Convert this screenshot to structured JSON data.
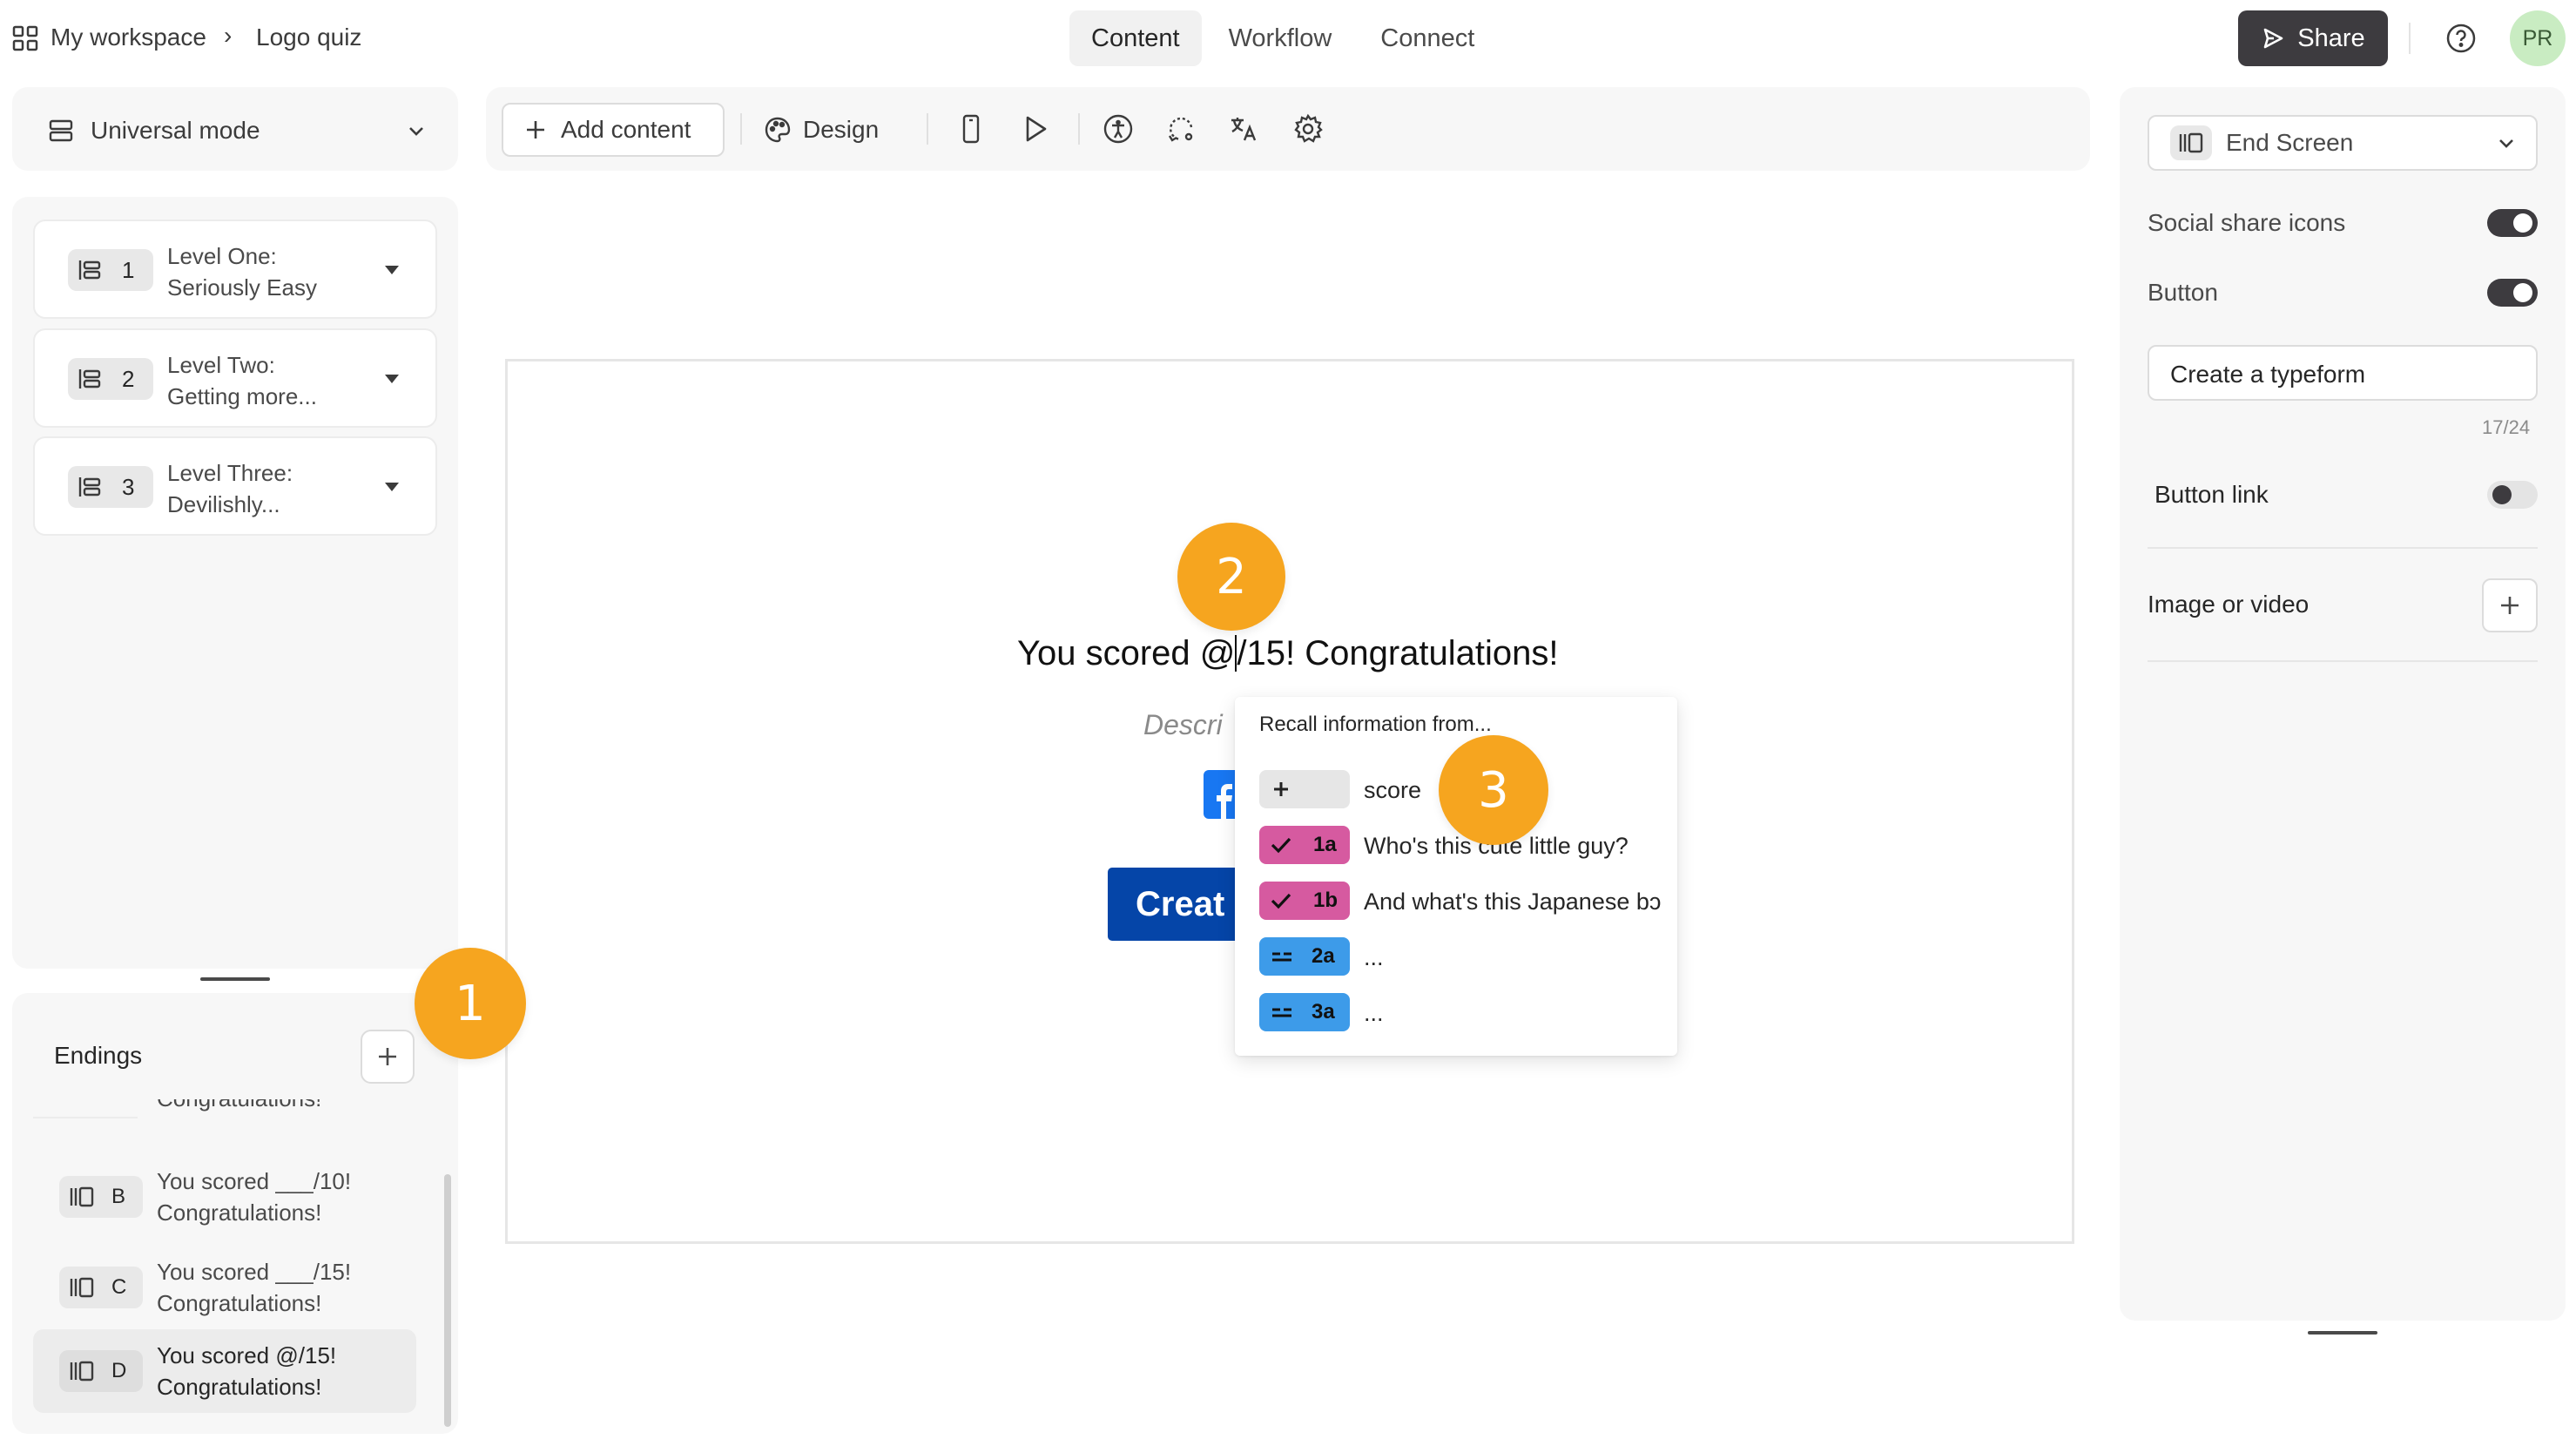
{
  "topbar": {
    "workspace": "My workspace",
    "separator": "›",
    "form_name": "Logo quiz",
    "tabs": [
      {
        "label": "Content",
        "active": true
      },
      {
        "label": "Workflow",
        "active": false
      },
      {
        "label": "Connect",
        "active": false
      }
    ],
    "share_label": "Share",
    "avatar_initials": "PR"
  },
  "left": {
    "mode_label": "Universal mode",
    "questions": [
      {
        "number": "1",
        "line1": "Level One:",
        "line2": "Seriously Easy"
      },
      {
        "number": "2",
        "line1": "Level Two:",
        "line2": "Getting more..."
      },
      {
        "number": "3",
        "line1": "Level Three:",
        "line2": "Devilishly..."
      }
    ],
    "endings_title": "Endings",
    "endings_partial": "Congratulations!",
    "endings": [
      {
        "letter": "B",
        "line1": "You scored ___/10!",
        "line2": "Congratulations!"
      },
      {
        "letter": "C",
        "line1": "You scored ___/15!",
        "line2": "Congratulations!"
      },
      {
        "letter": "D",
        "line1": "You scored @/15!",
        "line2": "Congratulations!"
      }
    ]
  },
  "toolbar": {
    "add_content": "Add content",
    "design": "Design"
  },
  "canvas": {
    "headline_before": "You scored @",
    "headline_after": "/15! Congratulations!",
    "description_placeholder": "Descri",
    "button_partial": "Creat"
  },
  "recall": {
    "title": "Recall information from...",
    "items": [
      {
        "tag": "",
        "icon": "plus-icon",
        "label": "score",
        "color": "#e6e6e6"
      },
      {
        "tag": "1a",
        "icon": "check-icon",
        "label": "Who's this cute little guy?",
        "color": "#d65aa0"
      },
      {
        "tag": "1b",
        "icon": "check-icon",
        "label": "And what's this Japanese bɔ",
        "color": "#d65aa0"
      },
      {
        "tag": "2a",
        "icon": "equals-icon",
        "label": "...",
        "color": "#3d9be9"
      },
      {
        "tag": "3a",
        "icon": "equals-icon",
        "label": "...",
        "color": "#3d9be9"
      }
    ]
  },
  "right": {
    "screen_type": "End Screen",
    "social_share_label": "Social share icons",
    "social_share_on": true,
    "button_label": "Button",
    "button_on": true,
    "button_text_value": "Create a typeform",
    "char_count": "17/24",
    "button_link_label": "Button link",
    "button_link_on": false,
    "image_video_label": "Image or video"
  },
  "callouts": {
    "one": "1",
    "two": "2",
    "three": "3"
  },
  "colors": {
    "accent_orange": "#f6a51f",
    "share_bg": "#3d3b3f",
    "avatar_bg": "#c9ecc2",
    "cta_blue": "#0545a8",
    "fb_blue": "#1877f2"
  }
}
